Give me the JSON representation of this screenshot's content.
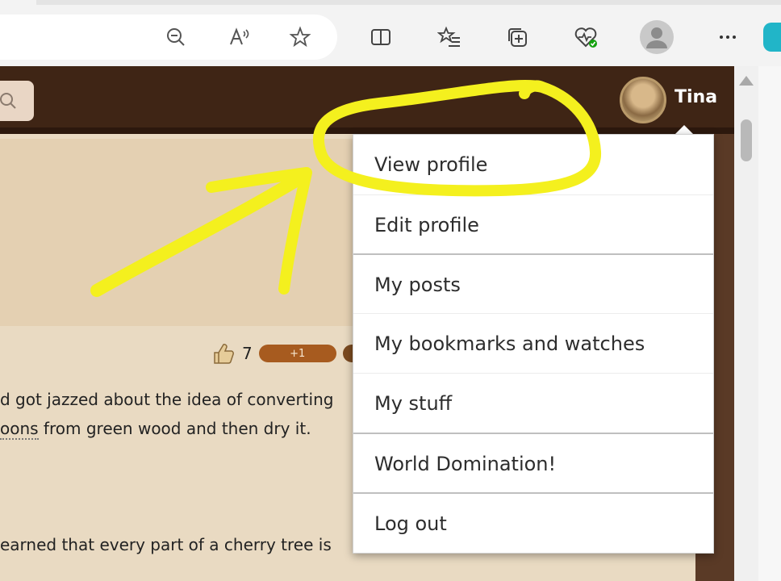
{
  "browser": {
    "toolbar_icons": [
      "zoom-out-icon",
      "read-aloud-icon",
      "favorite-star-icon",
      "split-screen-icon",
      "favorites-list-icon",
      "collections-icon",
      "browser-essentials-icon",
      "profile-avatar-icon",
      "more-options-icon"
    ]
  },
  "header": {
    "username": "Tina"
  },
  "post": {
    "reaction_count": "7",
    "react_label": "+1",
    "line1": "d got jazzed about the idea of converting",
    "line2_link": "oons",
    "line2_rest": " from green wood and then dry it.",
    "line3": "earned that every part of a cherry tree is"
  },
  "menu": {
    "items": [
      {
        "label": "View profile"
      },
      {
        "label": "Edit profile"
      },
      {
        "label": "My posts"
      },
      {
        "label": "My bookmarks and watches"
      },
      {
        "label": "My stuff"
      },
      {
        "label": "World Domination!"
      },
      {
        "label": "Log out"
      }
    ]
  },
  "colors": {
    "header_bg": "#3f2515",
    "content_bg": "#e9dac2",
    "annotation": "#f4f01e",
    "react_pill": "#a75b1f"
  }
}
